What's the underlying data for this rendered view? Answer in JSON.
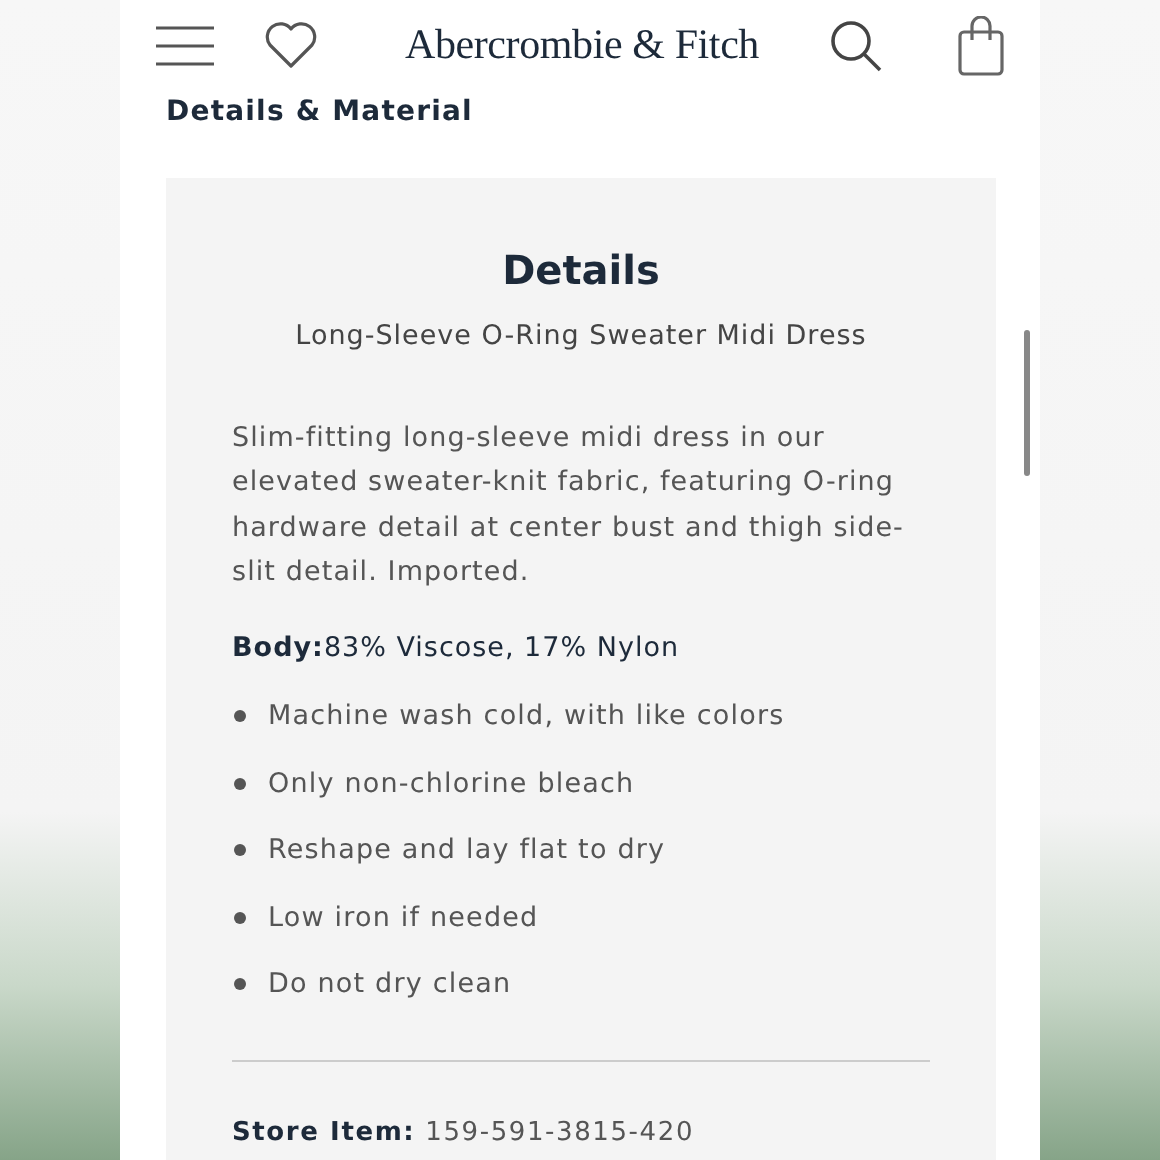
{
  "header": {
    "logo": "Abercrombie & Fitch"
  },
  "section_title": "Details & Material",
  "details": {
    "title": "Details",
    "product_name": "Long-Sleeve O-Ring Sweater Midi Dress",
    "description": "Slim-fitting long-sleeve midi dress in our elevated sweater-knit fabric, featuring O-ring hardware detail at center bust and thigh side-slit detail. Imported.",
    "composition": "**Body:**83% Viscose, 17% Nylon",
    "care": [
      "Machine wash cold, with like colors",
      "Only non-chlorine bleach",
      "Reshape and lay flat to dry",
      "Low iron if needed",
      "Do not dry clean"
    ],
    "store_item": "**Store Item:** 159-591-3815-420"
  }
}
